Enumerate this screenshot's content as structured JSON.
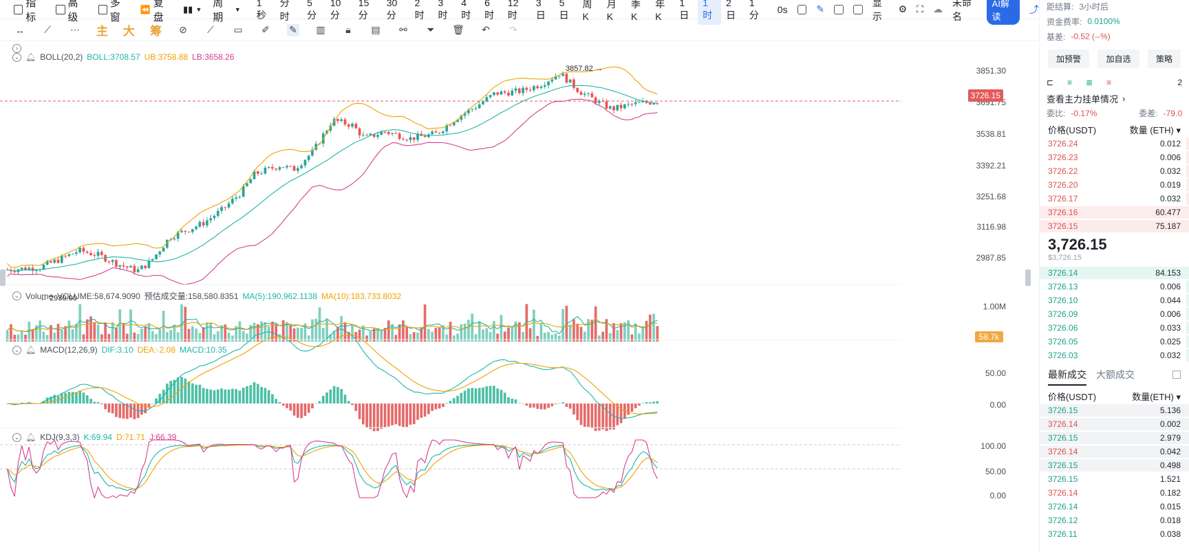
{
  "toolbar": {
    "main_items": [
      "指标",
      "高级",
      "多窗",
      "复盘"
    ],
    "period_dropdown": "周期",
    "periods": [
      "1秒",
      "分时",
      "5分",
      "10分",
      "15分",
      "30分",
      "2时",
      "3时",
      "4时",
      "6时",
      "12时",
      "3日",
      "5日",
      "周K",
      "月K",
      "季K",
      "年K",
      "1日",
      "1时",
      "2日",
      "1分"
    ],
    "active_period": "1时",
    "countdown": "0s",
    "display_label": "显示",
    "layout_name": "未命名",
    "ai_label": "AI解读"
  },
  "drawbar": {
    "text_tools": [
      "主",
      "大",
      "筹"
    ]
  },
  "indicators": {
    "boll": {
      "name": "BOLL(20,2)",
      "boll": "BOLL:3708.57",
      "ub": "UB:3758.88",
      "lb": "LB:3658.26"
    },
    "volume": {
      "name": "Volume",
      "volume": "VOLUME:58,674.9090",
      "est": "预估成交量:158,580.8351",
      "ma5": "MA(5):190,962.1138",
      "ma10": "MA(10):183,733.8032"
    },
    "macd": {
      "name": "MACD(12,26,9)",
      "dif": "DIF:3.10",
      "dea": "DEA:-2.08",
      "macd": "MACD:10.35"
    },
    "kdj": {
      "name": "KDJ(9,3,3)",
      "k": "K:69.94",
      "d": "D:71.71",
      "j": "J:66.39"
    }
  },
  "axes": {
    "price": [
      "3851.30",
      "3691.75",
      "3538.81",
      "3392.21",
      "3251.68",
      "3116.98",
      "2987.85"
    ],
    "current_price": "3726.15",
    "volume": [
      "1.00M"
    ],
    "current_volume": "58.7k",
    "macd": [
      "50.00",
      "0.00"
    ],
    "kdj": [
      "100.00",
      "50.00",
      "0.00"
    ]
  },
  "annotations": {
    "high": "3857.82",
    "low": "2930.00"
  },
  "colors": {
    "up": "#26a69a",
    "down": "#ef5350",
    "boll_mid": "#1fb5a8",
    "boll_ub": "#f0a000",
    "boll_lb": "#d63c8f",
    "accent": "#2a6ae6"
  },
  "chart_data": {
    "type": "candlestick",
    "price_range": [
      2930.0,
      3860.0
    ],
    "high": 3857.82,
    "low": 2930.0,
    "last": 3726.15
  },
  "right_panel": {
    "settle_label": "距结算:",
    "settle_value": "3小时后",
    "funding_label": "资金费率:",
    "funding_value": "0.0100%",
    "basis_label": "基差:",
    "basis_value": "-0.52 (--%)",
    "buttons": [
      "加预警",
      "加自选",
      "策略"
    ],
    "page_num": "2",
    "depth_link": "查看主力挂单情况",
    "ratio_label": "委比:",
    "ratio_value": "-0.17%",
    "diff_label": "委差:",
    "diff_value": "-79.0",
    "ob_price_head": "价格(USDT)",
    "ob_qty_head": "数量 (ETH)",
    "asks": [
      {
        "price": "3726.24",
        "qty": "0.012"
      },
      {
        "price": "3726.23",
        "qty": "0.006"
      },
      {
        "price": "3726.22",
        "qty": "0.032"
      },
      {
        "price": "3726.20",
        "qty": "0.019"
      },
      {
        "price": "3726.17",
        "qty": "0.032"
      },
      {
        "price": "3726.16",
        "qty": "60.477"
      },
      {
        "price": "3726.15",
        "qty": "75.187"
      }
    ],
    "last_price": "3,726.15",
    "last_price_usd": "$3,726.15",
    "bids": [
      {
        "price": "3726.14",
        "qty": "84.153"
      },
      {
        "price": "3726.13",
        "qty": "0.006"
      },
      {
        "price": "3726.10",
        "qty": "0.044"
      },
      {
        "price": "3726.09",
        "qty": "0.006"
      },
      {
        "price": "3726.06",
        "qty": "0.033"
      },
      {
        "price": "3726.05",
        "qty": "0.025"
      },
      {
        "price": "3726.03",
        "qty": "0.032"
      }
    ],
    "trade_tabs": [
      "最新成交",
      "大额成交"
    ],
    "trade_price_head": "价格(USDT)",
    "trade_qty_head": "数量(ETH)",
    "trades": [
      {
        "price": "3726.15",
        "qty": "5.136",
        "side": "buy"
      },
      {
        "price": "3726.14",
        "qty": "0.002",
        "side": "sell"
      },
      {
        "price": "3726.15",
        "qty": "2.979",
        "side": "buy"
      },
      {
        "price": "3726.14",
        "qty": "0.042",
        "side": "sell"
      },
      {
        "price": "3726.15",
        "qty": "0.498",
        "side": "buy"
      },
      {
        "price": "3726.15",
        "qty": "1.521",
        "side": "buy"
      },
      {
        "price": "3726.14",
        "qty": "0.182",
        "side": "sell"
      },
      {
        "price": "3726.14",
        "qty": "0.015",
        "side": "buy"
      },
      {
        "price": "3726.12",
        "qty": "0.018",
        "side": "buy"
      },
      {
        "price": "3726.11",
        "qty": "0.038",
        "side": "buy"
      }
    ]
  }
}
